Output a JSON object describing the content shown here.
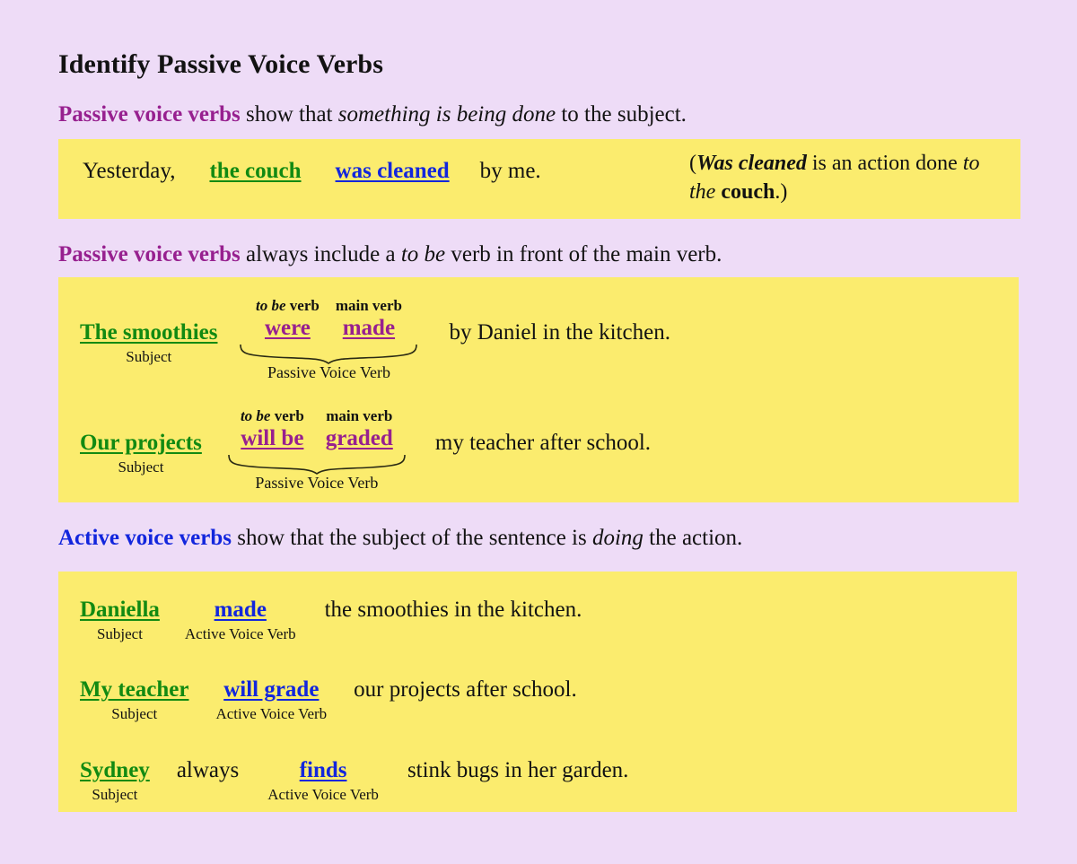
{
  "title": "Identify Passive Voice Verbs",
  "colors": {
    "background": "#eedcf7",
    "panel": "#fbec6e",
    "passive_keyword": "#97208f",
    "active_keyword": "#1226dd",
    "subject": "#128a12",
    "text": "#121212"
  },
  "explanations": {
    "passive_intro": {
      "keyword": "Passive voice verbs",
      "before_italic": " show that ",
      "italic": "something is being done",
      "after_italic": " to the subject."
    },
    "passive_tobe": {
      "keyword": "Passive voice verbs",
      "before_italic": " always include a ",
      "italic": "to be",
      "after_italic": " verb in front of the main verb."
    },
    "active_intro": {
      "keyword": "Active voice verbs",
      "before_italic": " show that the subject of the sentence is ",
      "italic": "doing",
      "after_italic": " the action."
    }
  },
  "example_box": {
    "lead": "Yesterday,",
    "subject": "the couch",
    "verb": "was cleaned",
    "tail": "by me.",
    "note": {
      "open_paren": "(",
      "bold_italic": "Was cleaned",
      "mid": " is an action done ",
      "italic": "to the",
      "bold": " couch",
      "close": ".)"
    }
  },
  "passive_diagrams": [
    {
      "subject": "The smoothies",
      "subject_label": "Subject",
      "tobe_tag_italic": "to be",
      "tobe_tag_rest": " verb",
      "tobe_verb": "were",
      "main_tag": "main verb",
      "main_verb": "made",
      "brace_label": "Passive Voice Verb",
      "tail": "by Daniel in the kitchen."
    },
    {
      "subject": "Our projects",
      "subject_label": "Subject",
      "tobe_tag_italic": "to be",
      "tobe_tag_rest": " verb",
      "tobe_verb": "will be",
      "main_tag": "main verb",
      "main_verb": "graded",
      "brace_label": "Passive Voice Verb",
      "tail": "my teacher after school."
    }
  ],
  "active_examples": [
    {
      "subject": "Daniella",
      "subject_label": "Subject",
      "mid": "",
      "verb": "made",
      "verb_label": "Active Voice Verb",
      "tail": "the smoothies in the kitchen."
    },
    {
      "subject": "My teacher",
      "subject_label": "Subject",
      "mid": "",
      "verb": "will grade",
      "verb_label": "Active Voice Verb",
      "tail": "our projects after school."
    },
    {
      "subject": "Sydney",
      "subject_label": "Subject",
      "mid": "always",
      "verb": "finds",
      "verb_label": "Active Voice Verb",
      "tail": "stink bugs in her garden."
    }
  ]
}
